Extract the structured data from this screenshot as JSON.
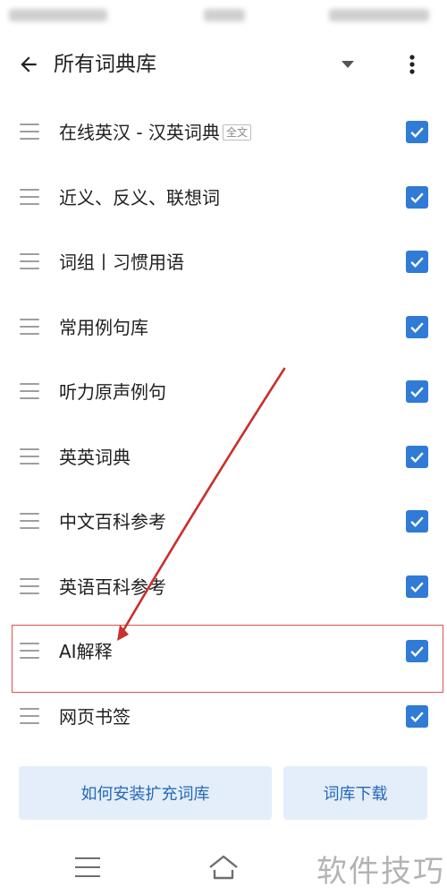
{
  "header": {
    "title": "所有词典库"
  },
  "dictionaries": [
    {
      "label": "在线英汉 - 汉英词典",
      "badge": "全文",
      "checked": true
    },
    {
      "label": "近义、反义、联想词",
      "checked": true
    },
    {
      "label": "词组丨习惯用语",
      "checked": true
    },
    {
      "label": "常用例句库",
      "checked": true
    },
    {
      "label": "听力原声例句",
      "checked": true
    },
    {
      "label": "英英词典",
      "checked": true
    },
    {
      "label": "中文百科参考",
      "checked": true
    },
    {
      "label": "英语百科参考",
      "checked": true
    },
    {
      "label": "AI解释",
      "checked": true
    },
    {
      "label": "网页书签",
      "checked": true
    }
  ],
  "buttons": {
    "install": "如何安装扩充词库",
    "download": "词库下载"
  },
  "watermark": "软件技巧",
  "colors": {
    "accent": "#2f7bd6",
    "button_bg": "#e3eefa",
    "button_text": "#2567b8",
    "highlight": "#d9534f"
  },
  "icons": {
    "back": "arrow-left-icon",
    "dropdown": "caret-down-icon",
    "menu": "more-vert-icon",
    "drag": "drag-handle-icon",
    "check": "check-icon",
    "nav_menu": "menu-icon",
    "nav_home": "home-icon"
  }
}
